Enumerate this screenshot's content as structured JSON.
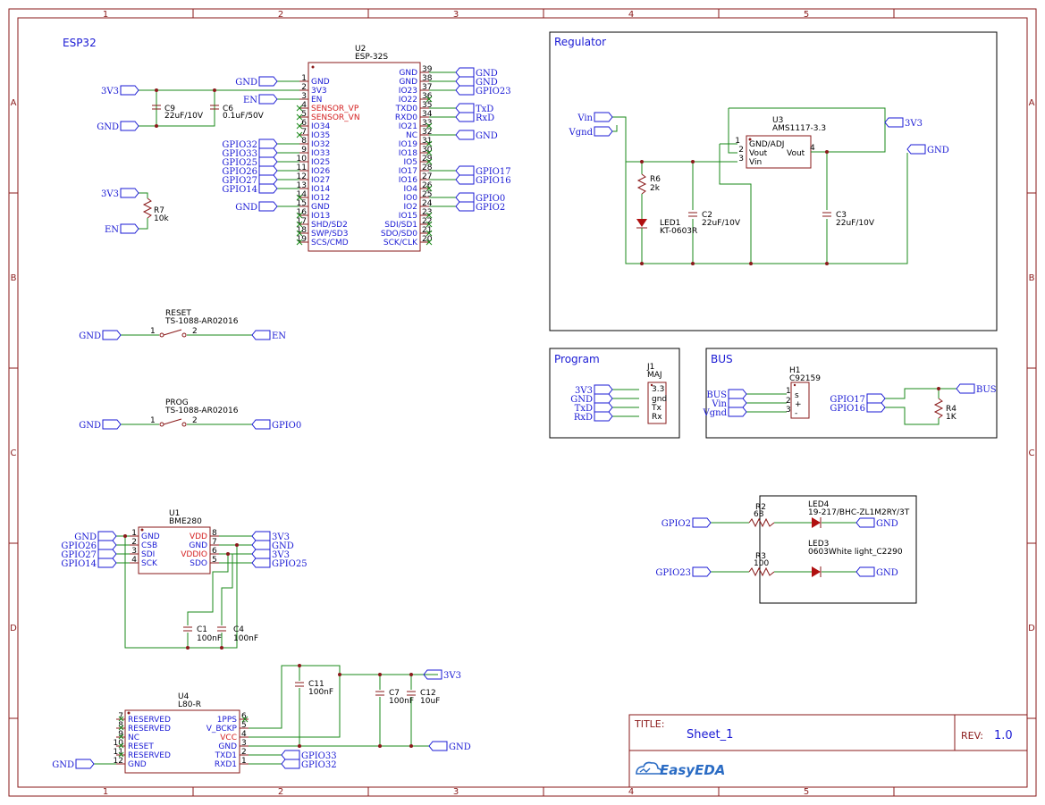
{
  "sheet": {
    "col_zones": [
      "1",
      "2",
      "3",
      "4",
      "5"
    ],
    "row_zones": [
      "A",
      "B",
      "C",
      "D"
    ],
    "title_label": "TITLE:",
    "title_value": "Sheet_1",
    "rev_label": "REV:",
    "rev_value": "1.0",
    "logo_text": "EasyEDA"
  },
  "groups": {
    "esp32": "ESP32",
    "regulator": "Regulator",
    "program": "Program",
    "bus": "BUS"
  },
  "u2": {
    "ref": "U2",
    "value": "ESP-32S",
    "left_pins": [
      {
        "num": "1",
        "name": "GND"
      },
      {
        "num": "2",
        "name": "3V3"
      },
      {
        "num": "3",
        "name": "EN"
      },
      {
        "num": "4",
        "name": "SENSOR_VP",
        "red": true
      },
      {
        "num": "5",
        "name": "SENSOR_VN",
        "red": true
      },
      {
        "num": "6",
        "name": "IO34"
      },
      {
        "num": "7",
        "name": "IO35"
      },
      {
        "num": "8",
        "name": "IO32"
      },
      {
        "num": "9",
        "name": "IO33"
      },
      {
        "num": "10",
        "name": "IO25"
      },
      {
        "num": "11",
        "name": "IO26"
      },
      {
        "num": "12",
        "name": "IO27"
      },
      {
        "num": "13",
        "name": "IO14"
      },
      {
        "num": "14",
        "name": "IO12"
      },
      {
        "num": "15",
        "name": "GND"
      },
      {
        "num": "16",
        "name": "IO13"
      },
      {
        "num": "17",
        "name": "SHD/SD2"
      },
      {
        "num": "18",
        "name": "SWP/SD3"
      },
      {
        "num": "19",
        "name": "SCS/CMD"
      }
    ],
    "right_pins": [
      {
        "num": "39",
        "name": "GND"
      },
      {
        "num": "38",
        "name": "GND"
      },
      {
        "num": "37",
        "name": "IO23"
      },
      {
        "num": "36",
        "name": "IO22"
      },
      {
        "num": "35",
        "name": "TXD0"
      },
      {
        "num": "34",
        "name": "RXD0"
      },
      {
        "num": "33",
        "name": "IO21"
      },
      {
        "num": "32",
        "name": "NC"
      },
      {
        "num": "31",
        "name": "IO19"
      },
      {
        "num": "30",
        "name": "IO18"
      },
      {
        "num": "29",
        "name": "IO5"
      },
      {
        "num": "28",
        "name": "IO17"
      },
      {
        "num": "27",
        "name": "IO16"
      },
      {
        "num": "26",
        "name": "IO4"
      },
      {
        "num": "25",
        "name": "IO0"
      },
      {
        "num": "24",
        "name": "IO2"
      },
      {
        "num": "23",
        "name": "IO15"
      },
      {
        "num": "22",
        "name": "SDI/SD1"
      },
      {
        "num": "21",
        "name": "SDO/SD0"
      },
      {
        "num": "20",
        "name": "SCK/CLK"
      }
    ],
    "left_nets": [
      "GPIO32",
      "GPIO33",
      "GPIO25",
      "GPIO26",
      "GPIO27",
      "GPIO14"
    ],
    "left_gnd_top": "GND",
    "en_net": "EN",
    "left_gnd_15": "GND",
    "right_nets": [
      {
        "pin": "39",
        "net": "GND"
      },
      {
        "pin": "38",
        "net": "GND"
      },
      {
        "pin": "37",
        "net": "GPIO23"
      },
      {
        "pin": "35",
        "net": "TxD"
      },
      {
        "pin": "34",
        "net": "RxD"
      },
      {
        "pin": "32",
        "net": "GND"
      },
      {
        "pin": "28",
        "net": "GPIO17"
      },
      {
        "pin": "27",
        "net": "GPIO16"
      },
      {
        "pin": "25",
        "net": "GPIO0"
      },
      {
        "pin": "24",
        "net": "GPIO2"
      }
    ]
  },
  "esp_misc": {
    "c9_ref": "C9",
    "c9_val": "22uF/10V",
    "c6_ref": "C6",
    "c6_val": "0.1uF/50V",
    "net_3v3": "3V3",
    "net_gnd": "GND",
    "r7_ref": "R7",
    "r7_val": "10k",
    "net_en": "EN"
  },
  "reset": {
    "ref": "RESET",
    "value": "TS-1088-AR02016",
    "pin1": "1",
    "pin2": "2",
    "left_net": "GND",
    "right_net": "EN"
  },
  "prog": {
    "ref": "PROG",
    "value": "TS-1088-AR02016",
    "pin1": "1",
    "pin2": "2",
    "left_net": "GND",
    "right_net": "GPIO0"
  },
  "regulator": {
    "u3_ref": "U3",
    "u3_val": "AMS1117-3.3",
    "pins": [
      {
        "num": "1",
        "name": "GND/ADJ"
      },
      {
        "num": "2",
        "name": "Vout"
      },
      {
        "num": "3",
        "name": "Vin"
      }
    ],
    "pin4_num": "4",
    "pin4_name": "Vout",
    "net_vin": "Vin",
    "net_vgnd": "Vgnd",
    "net_3v3": "3V3",
    "net_gnd": "GND",
    "r6_ref": "R6",
    "r6_val": "2k",
    "led1_ref": "LED1",
    "led1_val": "KT-0603R",
    "c2_ref": "C2",
    "c2_val": "22uF/10V",
    "c3_ref": "C3",
    "c3_val": "22uF/10V"
  },
  "program": {
    "j1_ref": "J1",
    "j1_val": "MAJ",
    "pins": [
      "3.3",
      "gnd",
      "Tx",
      "Rx"
    ],
    "nets": [
      "3V3",
      "GND",
      "TxD",
      "RxD"
    ]
  },
  "bus": {
    "h1_ref": "H1",
    "h1_val": "C92159",
    "pins": [
      {
        "num": "1",
        "name": "s"
      },
      {
        "num": "2",
        "name": "+"
      },
      {
        "num": "3",
        "name": "-"
      }
    ],
    "nets": [
      "BUS",
      "Vin",
      "Vgnd"
    ],
    "gpio17": "GPIO17",
    "gpio16": "GPIO16",
    "r4_ref": "R4",
    "r4_val": "1K",
    "bus_net": "BUS"
  },
  "leds": {
    "r2_ref": "R2",
    "r2_val": "68",
    "r3_ref": "R3",
    "r3_val": "100",
    "led4_ref": "LED4",
    "led4_val": "19-217/BHC-ZL1M2RY/3T",
    "led3_ref": "LED3",
    "led3_val": "0603White light_C2290",
    "gpio2": "GPIO2",
    "gpio23": "GPIO23",
    "gnd": "GND"
  },
  "u1": {
    "ref": "U1",
    "value": "BME280",
    "left_pins": [
      {
        "num": "1",
        "name": "GND"
      },
      {
        "num": "2",
        "name": "CSB"
      },
      {
        "num": "3",
        "name": "SDI"
      },
      {
        "num": "4",
        "name": "SCK"
      }
    ],
    "right_pins": [
      {
        "num": "8",
        "name": "VDD",
        "red": true
      },
      {
        "num": "7",
        "name": "GND"
      },
      {
        "num": "6",
        "name": "VDDIO",
        "red": true
      },
      {
        "num": "5",
        "name": "SDO"
      }
    ],
    "left_nets": [
      "GND",
      "GPIO26",
      "GPIO27",
      "GPIO14"
    ],
    "right_nets": [
      "3V3",
      "GND",
      "3V3",
      "GPIO25"
    ],
    "c1_ref": "C1",
    "c1_val": "100nF",
    "c4_ref": "C4",
    "c4_val": "100nF"
  },
  "u4": {
    "ref": "U4",
    "value": "L80-R",
    "left_pins": [
      {
        "num": "7",
        "name": "RESERVED"
      },
      {
        "num": "8",
        "name": "RESERVED"
      },
      {
        "num": "9",
        "name": "NC"
      },
      {
        "num": "10",
        "name": "RESET"
      },
      {
        "num": "11",
        "name": "RESERVED"
      },
      {
        "num": "12",
        "name": "GND"
      }
    ],
    "right_pins": [
      {
        "num": "6",
        "name": "1PPS"
      },
      {
        "num": "5",
        "name": "V_BCKP"
      },
      {
        "num": "4",
        "name": "VCC",
        "red": true
      },
      {
        "num": "3",
        "name": "GND"
      },
      {
        "num": "2",
        "name": "TXD1"
      },
      {
        "num": "1",
        "name": "RXD1"
      }
    ],
    "gnd_net": "GND",
    "net_3v3": "3V3",
    "net_gnd": "GND",
    "gpio33": "GPIO33",
    "gpio32": "GPIO32",
    "c11_ref": "C11",
    "c11_val": "100nF",
    "c7_ref": "C7",
    "c7_val": "100nF",
    "c12_ref": "C12",
    "c12_val": "10uF"
  }
}
